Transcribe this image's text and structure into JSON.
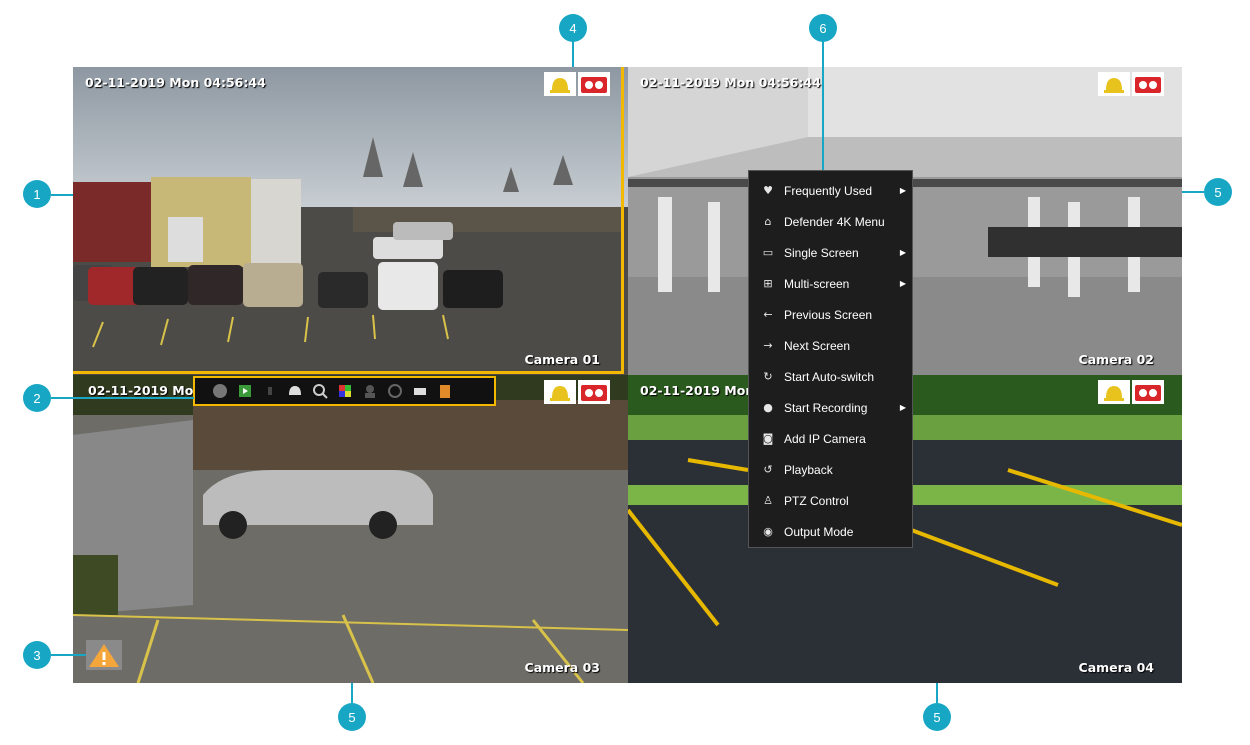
{
  "cameras": [
    {
      "timestamp": "02-11-2019 Mon 04:56:44",
      "name": "Camera 01"
    },
    {
      "timestamp": "02-11-2019 Mon 04:56:44",
      "name": "Camera 02"
    },
    {
      "timestamp": "02-11-2019 Mon",
      "name": "Camera 03"
    },
    {
      "timestamp": "02-11-2019 Mon",
      "name": "Camera 04"
    }
  ],
  "context_menu": [
    {
      "icon": "heart-icon",
      "label": "Frequently Used",
      "submenu": true
    },
    {
      "icon": "home-icon",
      "label": "Defender 4K Menu",
      "submenu": false
    },
    {
      "icon": "single-screen-icon",
      "label": "Single Screen",
      "submenu": true
    },
    {
      "icon": "multi-screen-icon",
      "label": "Multi-screen",
      "submenu": true
    },
    {
      "icon": "arrow-left-icon",
      "label": "Previous Screen",
      "submenu": false
    },
    {
      "icon": "arrow-right-icon",
      "label": "Next Screen",
      "submenu": false
    },
    {
      "icon": "refresh-icon",
      "label": "Start Auto-switch",
      "submenu": false
    },
    {
      "icon": "record-icon",
      "label": "Start Recording",
      "submenu": true
    },
    {
      "icon": "camera-add-icon",
      "label": "Add IP Camera",
      "submenu": false
    },
    {
      "icon": "playback-icon",
      "label": "Playback",
      "submenu": false
    },
    {
      "icon": "ptz-icon",
      "label": "PTZ Control",
      "submenu": false
    },
    {
      "icon": "output-icon",
      "label": "Output Mode",
      "submenu": false
    }
  ],
  "callouts": [
    "1",
    "2",
    "3",
    "4",
    "5",
    "5",
    "5",
    "6"
  ],
  "colors": {
    "accent": "#17a7c4",
    "selected_border": "#f5b800",
    "menu_bg": "#1d1d1d"
  }
}
